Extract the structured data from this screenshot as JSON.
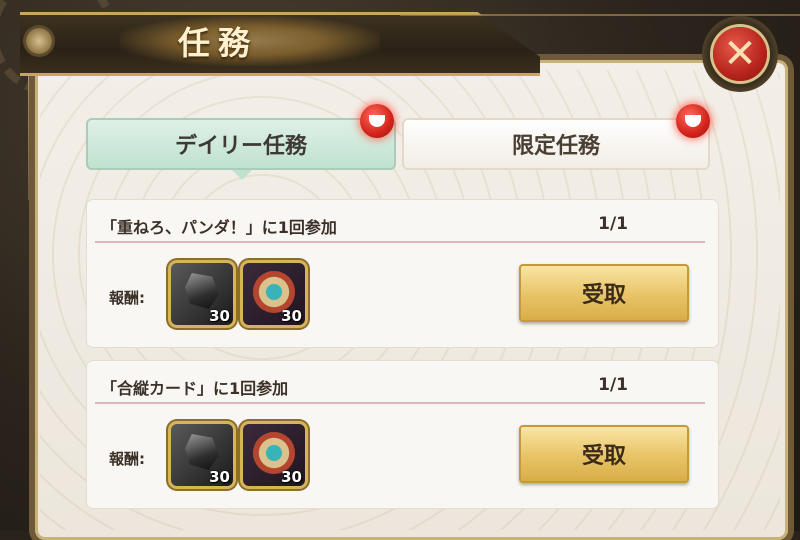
{
  "header": {
    "title": "任務"
  },
  "close": {
    "icon": "close-icon",
    "label": "✕"
  },
  "tabs": [
    {
      "label": "デイリー任務",
      "active": true,
      "badge": true
    },
    {
      "label": "限定任務",
      "active": false,
      "badge": true
    }
  ],
  "quests": [
    {
      "title": "「重ねろ、パンダ！」に1回参加",
      "progress": "1/1",
      "reward_label": "報酬:",
      "rewards": [
        {
          "icon": "ore-icon",
          "count": "30"
        },
        {
          "icon": "medal-icon",
          "count": "30"
        }
      ],
      "button": "受取"
    },
    {
      "title": "「合縦カード」に1回参加",
      "progress": "1/1",
      "reward_label": "報酬:",
      "rewards": [
        {
          "icon": "ore-icon",
          "count": "30"
        },
        {
          "icon": "medal-icon",
          "count": "30"
        }
      ],
      "button": "受取"
    }
  ],
  "colors": {
    "accent_green": "#bfe1cf",
    "gold": "#e9c66b",
    "badge_red": "#d3231b"
  }
}
